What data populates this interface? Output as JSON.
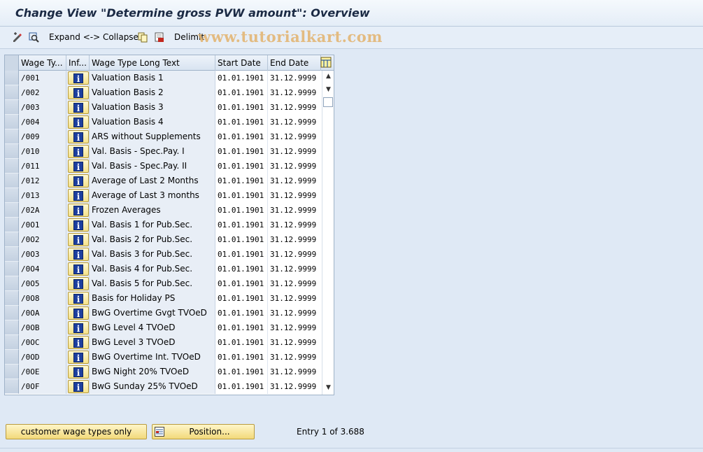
{
  "title": "Change View \"Determine gross PVW amount\": Overview",
  "watermark": "www.tutorialkart.com",
  "toolbar": {
    "expand_collapse_label": "Expand <-> Collapse",
    "delimit_label": "Delimit",
    "icons": [
      "change-display-icon",
      "select-all-icon",
      "copy-icon",
      "delete-icon"
    ]
  },
  "table": {
    "columns": [
      "Wage Ty...",
      "Inf...",
      "Wage Type Long Text",
      "Start Date",
      "End Date"
    ],
    "rows": [
      {
        "wage_type": "/001",
        "text": "Valuation Basis 1",
        "start": "01.01.1901",
        "end": "31.12.9999"
      },
      {
        "wage_type": "/002",
        "text": "Valuation Basis 2",
        "start": "01.01.1901",
        "end": "31.12.9999"
      },
      {
        "wage_type": "/003",
        "text": "Valuation Basis 3",
        "start": "01.01.1901",
        "end": "31.12.9999"
      },
      {
        "wage_type": "/004",
        "text": "Valuation Basis 4",
        "start": "01.01.1901",
        "end": "31.12.9999"
      },
      {
        "wage_type": "/009",
        "text": "ARS without Supplements",
        "start": "01.01.1901",
        "end": "31.12.9999"
      },
      {
        "wage_type": "/010",
        "text": "Val. Basis - Spec.Pay. I",
        "start": "01.01.1901",
        "end": "31.12.9999"
      },
      {
        "wage_type": "/011",
        "text": "Val. Basis - Spec.Pay. II",
        "start": "01.01.1901",
        "end": "31.12.9999"
      },
      {
        "wage_type": "/012",
        "text": "Average of Last 2 Months",
        "start": "01.01.1901",
        "end": "31.12.9999"
      },
      {
        "wage_type": "/013",
        "text": "Average of Last 3 months",
        "start": "01.01.1901",
        "end": "31.12.9999"
      },
      {
        "wage_type": "/02A",
        "text": "Frozen Averages",
        "start": "01.01.1901",
        "end": "31.12.9999"
      },
      {
        "wage_type": "/0O1",
        "text": "Val. Basis 1 for Pub.Sec.",
        "start": "01.01.1901",
        "end": "31.12.9999"
      },
      {
        "wage_type": "/0O2",
        "text": "Val. Basis 2 for Pub.Sec.",
        "start": "01.01.1901",
        "end": "31.12.9999"
      },
      {
        "wage_type": "/0O3",
        "text": "Val. Basis 3 for Pub.Sec.",
        "start": "01.01.1901",
        "end": "31.12.9999"
      },
      {
        "wage_type": "/0O4",
        "text": "Val. Basis 4 for Pub.Sec.",
        "start": "01.01.1901",
        "end": "31.12.9999"
      },
      {
        "wage_type": "/0O5",
        "text": "Val. Basis 5 for Pub.Sec.",
        "start": "01.01.1901",
        "end": "31.12.9999"
      },
      {
        "wage_type": "/0O8",
        "text": "Basis for Holiday PS",
        "start": "01.01.1901",
        "end": "31.12.9999"
      },
      {
        "wage_type": "/0OA",
        "text": "BwG Overtime Gvgt TVOeD",
        "start": "01.01.1901",
        "end": "31.12.9999"
      },
      {
        "wage_type": "/0OB",
        "text": "BwG Level 4 TVOeD",
        "start": "01.01.1901",
        "end": "31.12.9999"
      },
      {
        "wage_type": "/0OC",
        "text": "BwG Level 3 TVOeD",
        "start": "01.01.1901",
        "end": "31.12.9999"
      },
      {
        "wage_type": "/0OD",
        "text": "BwG Overtime Int. TVOeD",
        "start": "01.01.1901",
        "end": "31.12.9999"
      },
      {
        "wage_type": "/0OE",
        "text": "BwG Night 20% TVOeD",
        "start": "01.01.1901",
        "end": "31.12.9999"
      },
      {
        "wage_type": "/0OF",
        "text": "BwG Sunday 25% TVOeD",
        "start": "01.01.1901",
        "end": "31.12.9999"
      }
    ]
  },
  "footer": {
    "customer_button": "customer wage types only",
    "position_button": "Position...",
    "entry_info": "Entry 1 of 3.688"
  },
  "colors": {
    "background": "#dfe9f5",
    "button_yellow": "#f2d97a",
    "info_icon_blue": "#1d3f9e"
  }
}
